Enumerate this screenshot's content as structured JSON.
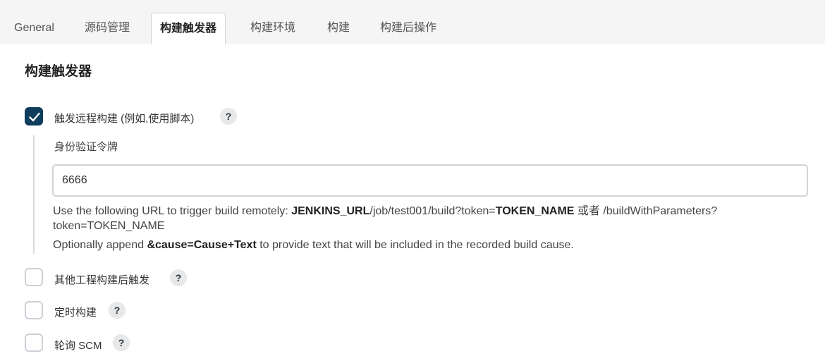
{
  "tabs": [
    {
      "label": "General"
    },
    {
      "label": "源码管理"
    },
    {
      "label": "构建触发器"
    },
    {
      "label": "构建环境"
    },
    {
      "label": "构建"
    },
    {
      "label": "构建后操作"
    }
  ],
  "section": {
    "title": "构建触发器"
  },
  "triggers": [
    {
      "label": "触发远程构建 (例如,使用脚本)",
      "checked": true
    },
    {
      "label": "其他工程构建后触发",
      "checked": false
    },
    {
      "label": "定时构建",
      "checked": false
    },
    {
      "label": "轮询 SCM",
      "checked": false
    }
  ],
  "help_glyph": "?",
  "remote": {
    "token_label": "身份验证令牌",
    "token_value": "6666",
    "line1_prefix": "Use the following URL to trigger build remotely: ",
    "line1_code1": "JENKINS_URL",
    "line1_mid": "/job/test001/build?token=",
    "line1_code2": "TOKEN_NAME",
    "line1_or": " 或者 ",
    "line1_suffix": "/buildWithParameters?",
    "line2_code": "token=TOKEN_NAME",
    "line3_prefix": "Optionally append ",
    "line3_code": "&cause=Cause+Text",
    "line3_suffix": " to provide text that will be included in the recorded build cause."
  },
  "colors": {
    "accent": "#0f3d5c",
    "tabbar_bg": "#f5f5f6"
  }
}
